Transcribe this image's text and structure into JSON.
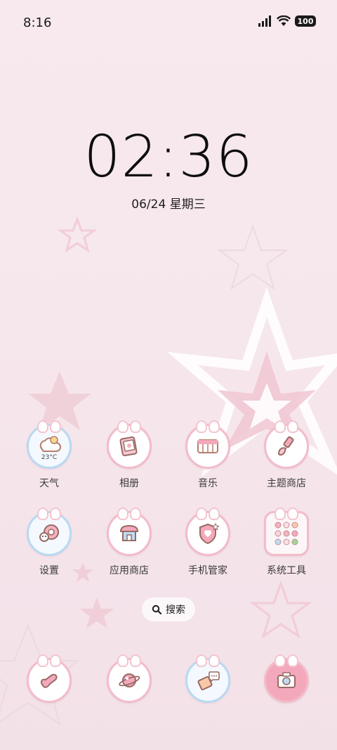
{
  "status_bar": {
    "time": "8:16",
    "battery": "100",
    "icons": [
      "signal-icon",
      "wifi-icon",
      "battery-icon"
    ]
  },
  "clock": {
    "time": "02:36",
    "date": "06/24 星期三"
  },
  "apps": [
    {
      "label": "天气",
      "icon": "weather-cloud-icon",
      "temp": "23°C"
    },
    {
      "label": "相册",
      "icon": "gallery-icon"
    },
    {
      "label": "音乐",
      "icon": "music-icon"
    },
    {
      "label": "主题商店",
      "icon": "theme-brush-icon"
    },
    {
      "label": "设置",
      "icon": "settings-icon"
    },
    {
      "label": "应用商店",
      "icon": "app-store-icon"
    },
    {
      "label": "手机管家",
      "icon": "security-shield-icon"
    },
    {
      "label": "系统工具",
      "icon": "system-tools-folder-icon"
    }
  ],
  "search": {
    "label": "搜索",
    "icon": "search-icon"
  },
  "dock": [
    {
      "icon": "phone-icon"
    },
    {
      "icon": "browser-planet-icon"
    },
    {
      "icon": "messages-icon"
    },
    {
      "icon": "camera-icon"
    }
  ],
  "colors": {
    "background": "#f6e7ec",
    "icon_ring_pink": "#f2bcc9",
    "icon_ring_blue": "#b9d9f2",
    "star_pink": "#eebccb"
  }
}
